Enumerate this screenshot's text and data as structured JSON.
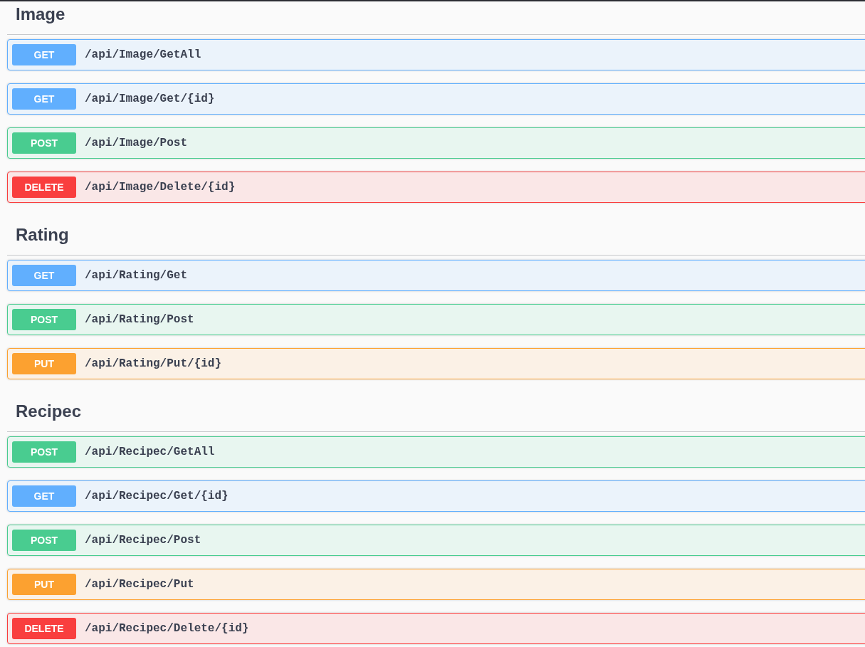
{
  "sections": [
    {
      "title": "Image",
      "endpoints": [
        {
          "kind": "get",
          "method": "GET",
          "path": "/api/Image/GetAll"
        },
        {
          "kind": "get",
          "method": "GET",
          "path": "/api/Image/Get/{id}"
        },
        {
          "kind": "post",
          "method": "POST",
          "path": "/api/Image/Post"
        },
        {
          "kind": "delete",
          "method": "DELETE",
          "path": "/api/Image/Delete/{id}"
        }
      ]
    },
    {
      "title": "Rating",
      "endpoints": [
        {
          "kind": "get",
          "method": "GET",
          "path": "/api/Rating/Get"
        },
        {
          "kind": "post",
          "method": "POST",
          "path": "/api/Rating/Post"
        },
        {
          "kind": "put",
          "method": "PUT",
          "path": "/api/Rating/Put/{id}"
        }
      ]
    },
    {
      "title": "Recipec",
      "endpoints": [
        {
          "kind": "post",
          "method": "POST",
          "path": "/api/Recipec/GetAll"
        },
        {
          "kind": "get",
          "method": "GET",
          "path": "/api/Recipec/Get/{id}"
        },
        {
          "kind": "post",
          "method": "POST",
          "path": "/api/Recipec/Post"
        },
        {
          "kind": "put",
          "method": "PUT",
          "path": "/api/Recipec/Put"
        },
        {
          "kind": "delete",
          "method": "DELETE",
          "path": "/api/Recipec/Delete/{id}"
        }
      ]
    }
  ]
}
